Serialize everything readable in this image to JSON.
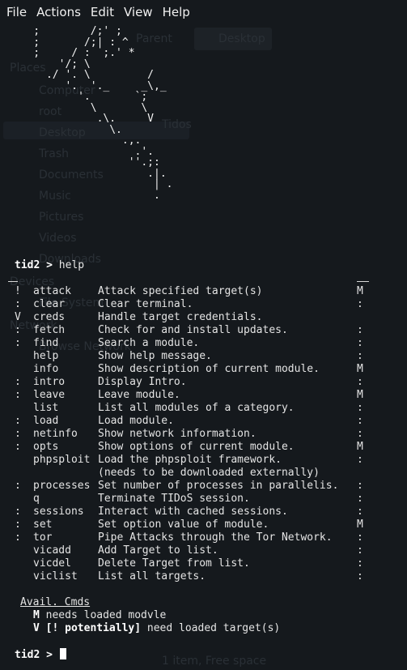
{
  "menubar": {
    "items": [
      "File",
      "Actions",
      "Edit",
      "View",
      "Help"
    ]
  },
  "ascii_art": "    ;        /;' ;\n    ;       /;| : ^\n    ;     / :  ;.' *\n        '/; \\\n      ./ '. \\         /\n         '.  '._     _\\,_\n           '.       `;\n             \\       \\\n              .\\.     V\n                \\.\n                  .,.\n                    .'.\n                   ''.;:\n                      .|.\n                       | .\n                       .",
  "prompt": {
    "text": "tid2 >",
    "first_command": " help"
  },
  "modules": [
    {
      "flag": "!",
      "name": "attack",
      "desc": "Attack specified target(s)",
      "mod": "M"
    },
    {
      "flag": ":",
      "name": "clear",
      "desc": "Clear terminal.",
      "mod": ":"
    },
    {
      "flag": "V",
      "name": "creds",
      "desc": "Handle target credentials.",
      "mod": ""
    },
    {
      "flag": ":",
      "name": "fetch",
      "desc": "Check for and install updates.",
      "mod": ":"
    },
    {
      "flag": ":",
      "name": "find",
      "desc": "Search a module.",
      "mod": ":"
    },
    {
      "flag": "",
      "name": "help",
      "desc": "Show help message.",
      "mod": ":"
    },
    {
      "flag": "",
      "name": "info",
      "desc": "Show description of current module.",
      "mod": "M"
    },
    {
      "flag": ":",
      "name": "intro",
      "desc": "Display Intro.",
      "mod": ":"
    },
    {
      "flag": ":",
      "name": "leave",
      "desc": "Leave module.",
      "mod": "M"
    },
    {
      "flag": "",
      "name": "list",
      "desc": "List all modules of a category.",
      "mod": ":"
    },
    {
      "flag": ":",
      "name": "load",
      "desc": "Load module.",
      "mod": ":"
    },
    {
      "flag": ":",
      "name": "netinfo",
      "desc": "Show network information.",
      "mod": ":"
    },
    {
      "flag": ":",
      "name": "opts",
      "desc": "Show options of current module.",
      "mod": "M"
    },
    {
      "flag": "",
      "name": "phpsploit",
      "desc": "Load the phpsploit framework.",
      "mod": ":"
    },
    {
      "flag": "",
      "name": "",
      "desc": "(needs to be downloaded externally)",
      "mod": ""
    },
    {
      "flag": ":",
      "name": "processes",
      "desc": "Set number of processes in parallelis.",
      "mod": ":"
    },
    {
      "flag": "",
      "name": "q",
      "desc": "Terminate TIDoS session.",
      "mod": ":"
    },
    {
      "flag": ":",
      "name": "sessions",
      "desc": "Interact with cached sessions.",
      "mod": ":"
    },
    {
      "flag": ":",
      "name": "set",
      "desc": "Set option value of module.",
      "mod": "M"
    },
    {
      "flag": ":",
      "name": "tor",
      "desc": "Pipe Attacks through the Tor Network.",
      "mod": ":"
    },
    {
      "flag": "",
      "name": "vicadd",
      "desc": "Add Target to list.",
      "mod": ":"
    },
    {
      "flag": "",
      "name": "vicdel",
      "desc": "Delete Target from list.",
      "mod": ":"
    },
    {
      "flag": "",
      "name": "viclist",
      "desc": "List all targets.",
      "mod": ":"
    }
  ],
  "legend": {
    "title": "Avail. Cmds",
    "m_key": "M",
    "m_text": " needs loaded modvle",
    "v_key": "V [! potentially]",
    "v_text": " need loaded target(s)"
  },
  "ghost": {
    "places_label": "Places",
    "devices_label": "Devices",
    "network_label": "Network",
    "toolbar_desktop": "Desktop",
    "toolbar_parent": "Parent",
    "sidebar": [
      "Computer",
      "root",
      "Desktop",
      "Trash",
      "Documents",
      "Music",
      "Pictures",
      "Videos",
      "Downloads"
    ],
    "file_label": "File System",
    "selection_label": "Tidos",
    "browse_label": "Browse Network",
    "status_label": "1 item, Free space"
  },
  "colors": {
    "background": "#15191d",
    "text": "#e4e4e4",
    "ghost": "#2a3036"
  }
}
